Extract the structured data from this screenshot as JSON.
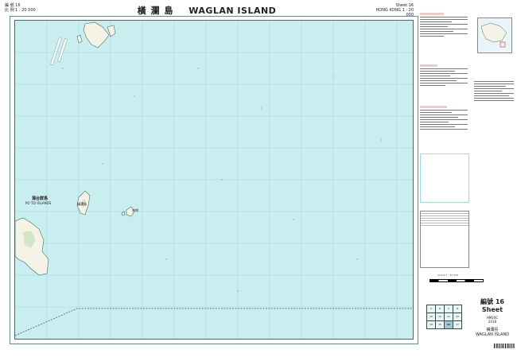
{
  "header": {
    "sheet_left_zh": "編 號 16",
    "scale_left_zh": "比 例 1 : 20 000",
    "title_zh": "橫 瀾 島",
    "title_en": "WAGLAN   ISLAND",
    "sheet_right_en": "Sheet 16",
    "scale_right_en": "HONG KONG 1 : 20 000"
  },
  "map": {
    "place_labels": {
      "po_toi_zh": "蒲台群島",
      "po_toi_en": "PO TOI ISLANDS",
      "waglan_zh": "橫瀾島",
      "sung_kong_zh": "宋崗"
    },
    "colors": {
      "sea": "#c8eef0",
      "land": "#f5f3e6",
      "grid": "#9adfe0",
      "coastline": "#4a6a6a",
      "boundary": "#555555"
    }
  },
  "sheet_info": {
    "title": "編號 16 Sheet",
    "series": "HM20C",
    "edition": "2018",
    "name_zh": "橫瀾島",
    "name_en": "WAGLAN ISLAND"
  },
  "sheet_index": {
    "cells": [
      "5",
      "6",
      "7",
      "8",
      "10",
      "11",
      "12",
      "13",
      "14",
      "15",
      "16",
      "17"
    ],
    "current": "16"
  },
  "scale": {
    "label": "SCALE 1 : 20 000"
  }
}
